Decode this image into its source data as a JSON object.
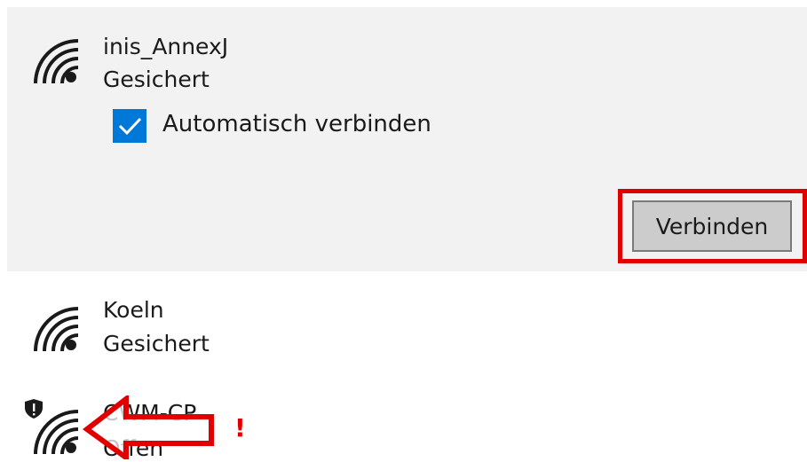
{
  "networks": [
    {
      "ssid": "inis_AnnexJ",
      "status": "Gesichert",
      "expanded": true,
      "auto_connect_label": "Automatisch verbinden",
      "auto_connect_checked": true,
      "connect_label": "Verbinden"
    },
    {
      "ssid": "Koeln",
      "status": "Gesichert"
    },
    {
      "ssid": "CWM-CP",
      "status": "Offen",
      "security_warning": true
    }
  ],
  "annotation": {
    "exclamation": "!"
  },
  "colors": {
    "accent": "#0078d7",
    "highlight": "#e00000",
    "selected_bg": "#f2f2f2"
  },
  "icons": [
    "wifi-signal-icon",
    "checkmark-icon",
    "shield-warning-icon",
    "arrow-left-icon"
  ]
}
